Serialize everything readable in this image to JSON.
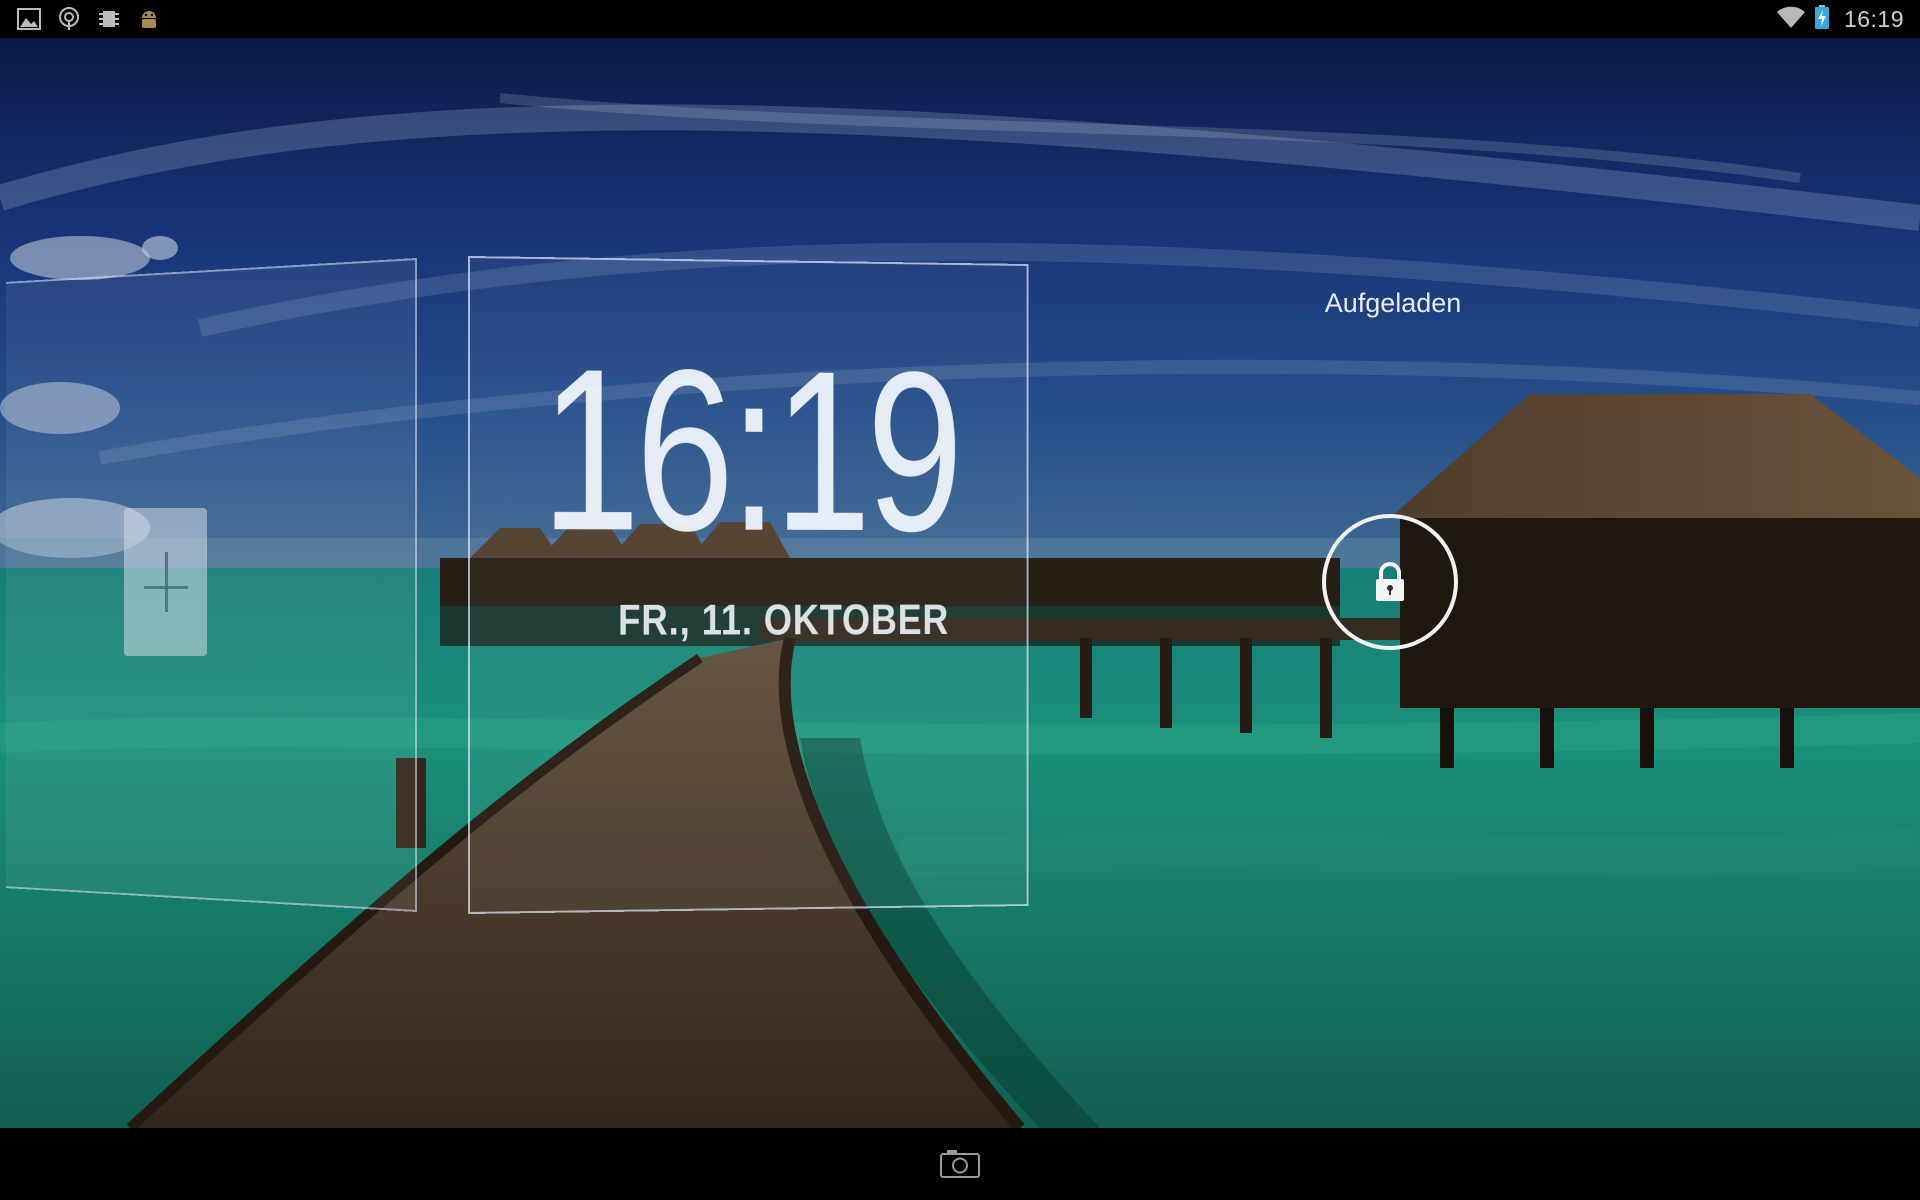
{
  "status_bar": {
    "time": "16:19",
    "notification_icons": [
      "gallery-icon",
      "tree-icon",
      "chip-icon",
      "android-icon"
    ],
    "system_icons": [
      "wifi-icon",
      "battery-charging-icon"
    ]
  },
  "lockscreen": {
    "clock": {
      "time": "16:19",
      "date": "FR., 11. OKTOBER"
    },
    "charge_status": "Aufgeladen",
    "unlock_icon": "lock-icon",
    "add_widget_icon": "plus-icon"
  },
  "nav_bar": {
    "camera_icon": "camera-icon"
  },
  "colors": {
    "sky_top": "#10265e",
    "water": "#1ea98a",
    "bar_background": "#000000"
  }
}
